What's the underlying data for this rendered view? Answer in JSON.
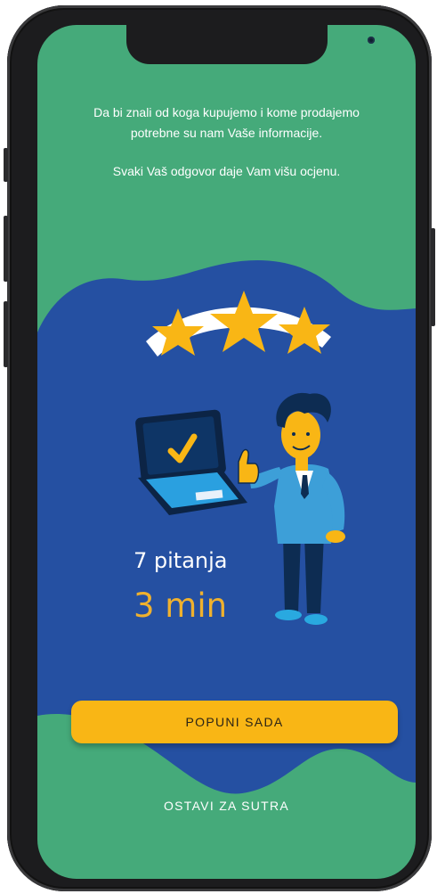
{
  "intro": {
    "line1": "Da bi znali od koga kupujemo i kome prodajemo",
    "line2": "potrebne su nam Vaše informacije.",
    "line3": "Svaki Vaš odgovor daje Vam višu ocjenu."
  },
  "illustration": {
    "stars_icon": "rating-stars-icon",
    "laptop_icon": "laptop-checkmark-icon",
    "character": "man-thumbs-up"
  },
  "survey": {
    "question_count": "7 pitanja",
    "duration": "3 min"
  },
  "actions": {
    "primary_label": "POPUNI SADA",
    "secondary_label": "OSTAVI ZA SUTRA"
  },
  "colors": {
    "background_green": "#45AA7A",
    "blob_blue": "#2550A2",
    "accent_yellow": "#F9B615",
    "duration_text": "#EFB12E"
  }
}
